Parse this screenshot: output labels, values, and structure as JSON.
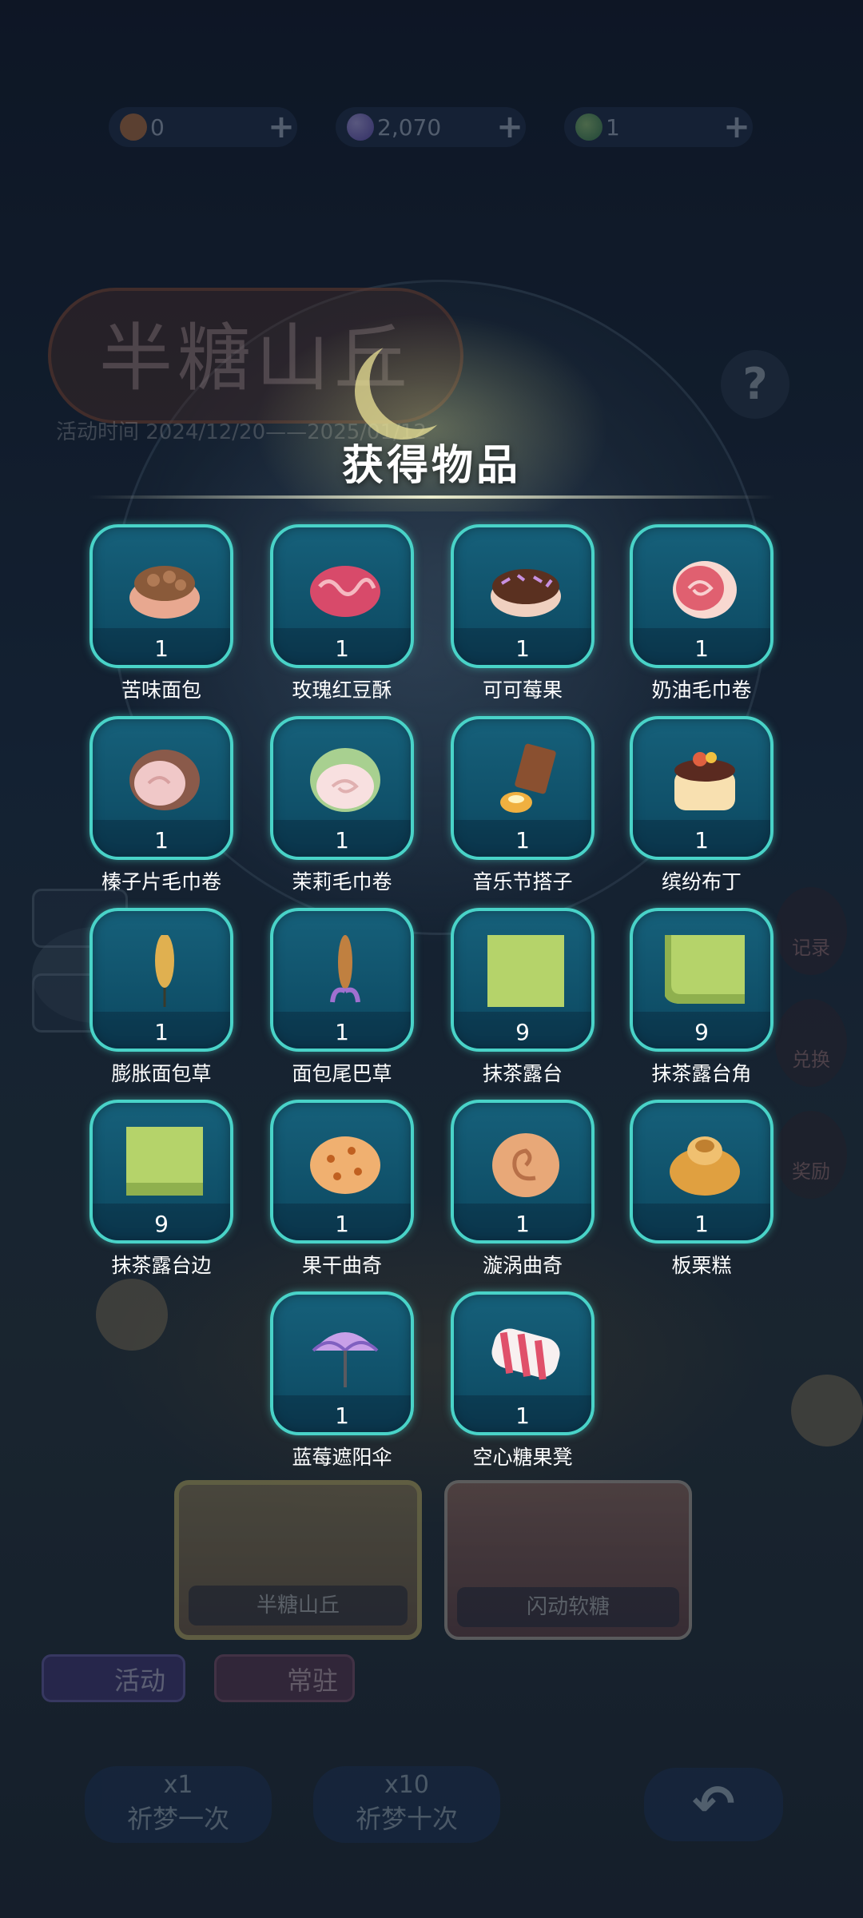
{
  "currencies": [
    {
      "icon": "flower-coin-icon",
      "value": "0",
      "plus": "+"
    },
    {
      "icon": "moon-gem-icon",
      "value": "2,070",
      "plus": "+"
    },
    {
      "icon": "leaf-ticket-icon",
      "value": "1",
      "plus": "+"
    }
  ],
  "background": {
    "event_title": "半糖山丘",
    "event_time": "活动时间 2024/12/20——2025/01/12",
    "help": "?",
    "side_buttons": [
      "记录",
      "兑换",
      "奖励"
    ]
  },
  "panel": {
    "title": "获得物品",
    "items": [
      {
        "name": "苦味面包",
        "qty": "1",
        "icon": "chocolate-bread-icon"
      },
      {
        "name": "玫瑰红豆酥",
        "qty": "1",
        "icon": "rose-pastry-icon"
      },
      {
        "name": "可可莓果",
        "qty": "1",
        "icon": "cocoa-donut-icon"
      },
      {
        "name": "奶油毛巾卷",
        "qty": "1",
        "icon": "cream-roll-icon"
      },
      {
        "name": "榛子片毛巾卷",
        "qty": "1",
        "icon": "hazelnut-roll-icon"
      },
      {
        "name": "茉莉毛巾卷",
        "qty": "1",
        "icon": "jasmine-roll-icon"
      },
      {
        "name": "音乐节搭子",
        "qty": "1",
        "icon": "chocolate-bar-pudding-icon"
      },
      {
        "name": "缤纷布丁",
        "qty": "1",
        "icon": "fruit-pudding-icon"
      },
      {
        "name": "膨胀面包草",
        "qty": "1",
        "icon": "bread-stick-plant-icon"
      },
      {
        "name": "面包尾巴草",
        "qty": "1",
        "icon": "baguette-flower-icon"
      },
      {
        "name": "抹茶露台",
        "qty": "9",
        "icon": "matcha-tile-icon"
      },
      {
        "name": "抹茶露台角",
        "qty": "9",
        "icon": "matcha-corner-tile-icon"
      },
      {
        "name": "抹茶露台边",
        "qty": "9",
        "icon": "matcha-edge-tile-icon"
      },
      {
        "name": "果干曲奇",
        "qty": "1",
        "icon": "dried-fruit-cookie-icon"
      },
      {
        "name": "漩涡曲奇",
        "qty": "1",
        "icon": "swirl-cookie-icon"
      },
      {
        "name": "板栗糕",
        "qty": "1",
        "icon": "chestnut-cake-icon"
      },
      {
        "name": "蓝莓遮阳伞",
        "qty": "1",
        "icon": "blueberry-parasol-icon"
      },
      {
        "name": "空心糖果凳",
        "qty": "1",
        "icon": "candy-stool-icon"
      }
    ]
  },
  "bottom": {
    "banners": [
      {
        "label": "半糖山丘"
      },
      {
        "label": "闪动软糖"
      }
    ],
    "tabs": [
      {
        "label": "活动"
      },
      {
        "label": "常驻"
      }
    ],
    "pray_once": {
      "count": "x1",
      "label": "祈梦一次"
    },
    "pray_ten": {
      "count": "x10",
      "label": "祈梦十次"
    }
  }
}
